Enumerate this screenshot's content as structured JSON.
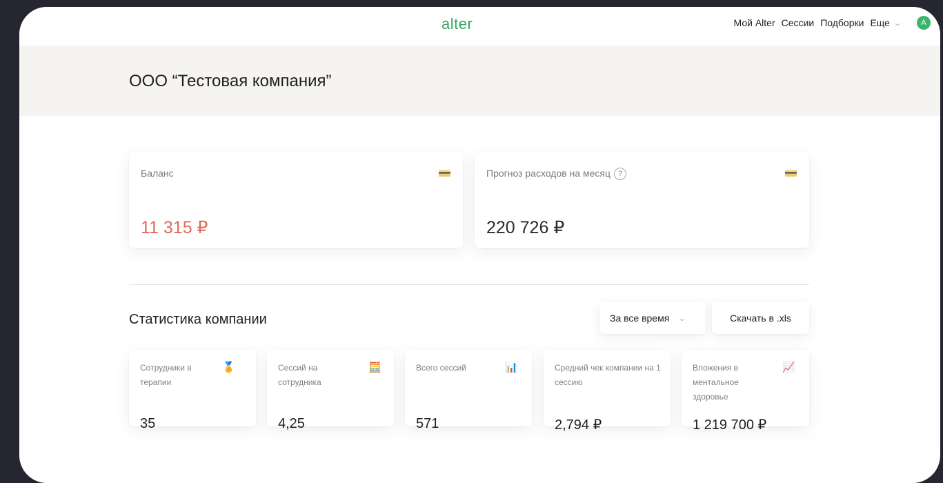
{
  "app": {
    "logo": "alter"
  },
  "nav": {
    "items": [
      "Мой Alter",
      "Сессии",
      "Подборки"
    ],
    "more": "Еще",
    "avatar_letter": "A"
  },
  "company": {
    "title": "ООО “Тестовая компания”"
  },
  "balance": {
    "label": "Баланс",
    "value": "11 315 ₽",
    "color": "#e06a5c",
    "icon": "credit-card-icon"
  },
  "forecast": {
    "label": "Прогноз расходов на месяц",
    "help": "?",
    "value": "220 726 ₽",
    "icon": "credit-card-icon"
  },
  "stats": {
    "title": "Статистика компании",
    "period": "За все время",
    "download": "Скачать в .xls",
    "cards": [
      {
        "label": "Сотрудники в терапии",
        "value": "35",
        "icon": "medal-icon"
      },
      {
        "label": "Сессий на сотрудника",
        "value": "4,25",
        "icon": "abacus-icon"
      },
      {
        "label": "Всего сессий",
        "value": "571",
        "icon": "bar-chart-icon"
      },
      {
        "label": "Средний чек компании на 1 сессию",
        "value": "2,794 ₽",
        "icon": "line-chart-icon-card"
      },
      {
        "label": "Вложения в ментальное здоровье",
        "value": "1 219 700 ₽",
        "icon": "trend-up-icon"
      }
    ]
  },
  "colors": {
    "accent": "#3aa566",
    "negative": "#e06a5c"
  }
}
